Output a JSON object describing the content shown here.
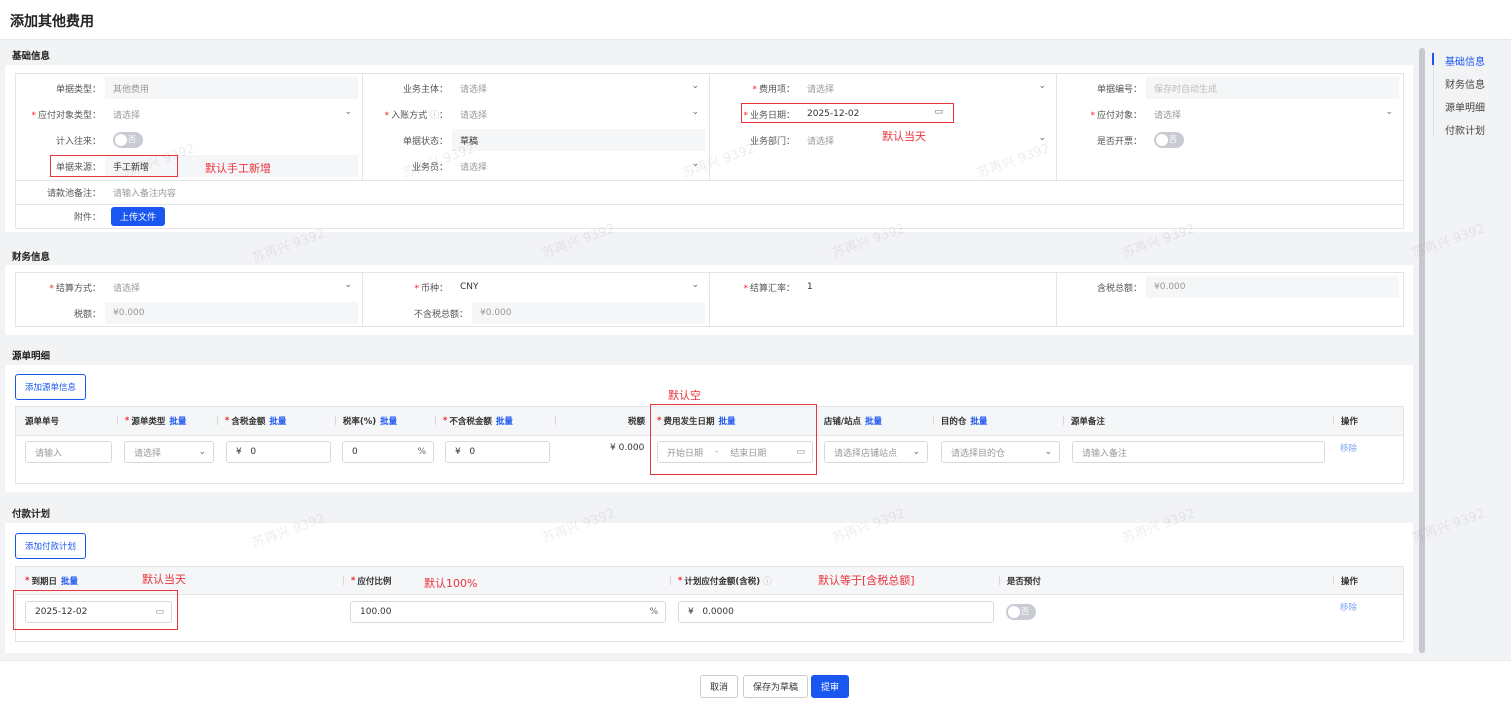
{
  "title": "添加其他费用",
  "watermark": "苏再兴 9392",
  "nav": [
    "基础信息",
    "财务信息",
    "源单明细",
    "付款计划"
  ],
  "basic": {
    "header": "基础信息",
    "doc_type": {
      "label": "单据类型：",
      "value": "其他费用"
    },
    "payee_type": {
      "label": "应付对象类型：",
      "placeholder": "请选择"
    },
    "include_ar": {
      "label": "计入往来：",
      "toggle": "否"
    },
    "doc_source": {
      "label": "单据来源：",
      "value": "手工新增"
    },
    "entity": {
      "label": "业务主体：",
      "placeholder": "请选择"
    },
    "account_method": {
      "label": "入账方式",
      "colon": "：",
      "placeholder": "请选择"
    },
    "doc_status": {
      "label": "单据状态：",
      "value": "草稿"
    },
    "salesman": {
      "label": "业务员：",
      "placeholder": "请选择"
    },
    "fee_item": {
      "label": "费用项：",
      "placeholder": "请选择"
    },
    "biz_date": {
      "label": "业务日期：",
      "value": "2025-12-02"
    },
    "dept": {
      "label": "业务部门：",
      "placeholder": "请选择"
    },
    "doc_no": {
      "label": "单据编号：",
      "placeholder": "保存时自动生成"
    },
    "payee": {
      "label": "应付对象：",
      "placeholder": "请选择"
    },
    "invoice": {
      "label": "是否开票：",
      "toggle": "否"
    },
    "remark": {
      "label": "请款池备注：",
      "placeholder": "请输入备注内容"
    },
    "attach": {
      "label": "附件：",
      "button": "上传文件"
    },
    "note_source": "默认手工新增",
    "note_date": "默认当天"
  },
  "finance": {
    "header": "财务信息",
    "settle": {
      "label": "结算方式：",
      "placeholder": "请选择"
    },
    "tax": {
      "label": "税额：",
      "value": "¥0.000"
    },
    "currency": {
      "label": "币种：",
      "value": "CNY"
    },
    "net_total": {
      "label": "不含税总额：",
      "value": "¥0.000"
    },
    "rate": {
      "label": "结算汇率：",
      "value": "1"
    },
    "gross_total": {
      "label": "含税总额：",
      "value": "¥0.000"
    }
  },
  "source": {
    "header": "源单明细",
    "add_button": "添加源单信息",
    "note": "默认空",
    "batch": "批量",
    "columns": [
      "源单单号",
      "源单类型",
      "含税金额",
      "税率(%)",
      "不含税金额",
      "税额",
      "费用发生日期",
      "店铺/站点",
      "目的仓",
      "源单备注",
      "操作"
    ],
    "row": {
      "no_ph": "请输入",
      "type_ph": "请选择",
      "gross": "0",
      "currency": "¥",
      "rate": "0",
      "pct": "%",
      "net": "0",
      "tax": "¥ 0.000",
      "start_ph": "开始日期",
      "dash": "-",
      "end_ph": "结束日期",
      "shop_ph": "请选择店铺站点",
      "wh_ph": "请选择目的仓",
      "remark_ph": "请输入备注",
      "remove": "移除"
    }
  },
  "plan": {
    "header": "付款计划",
    "add_button": "添加付款计划",
    "columns": [
      "到期日",
      "应付比例",
      "计划应付金额(含税)",
      "是否预付",
      "操作"
    ],
    "batch": "批量",
    "note_date": "默认当天",
    "note_ratio": "默认100%",
    "note_amount": "默认等于[含税总额]",
    "row": {
      "date": "2025-12-02",
      "ratio": "100.00",
      "pct": "%",
      "currency": "¥",
      "amount": "0.0000",
      "prepay": "否",
      "remove": "移除"
    }
  },
  "footer": {
    "cancel": "取消",
    "draft": "保存为草稿",
    "submit": "提审"
  }
}
